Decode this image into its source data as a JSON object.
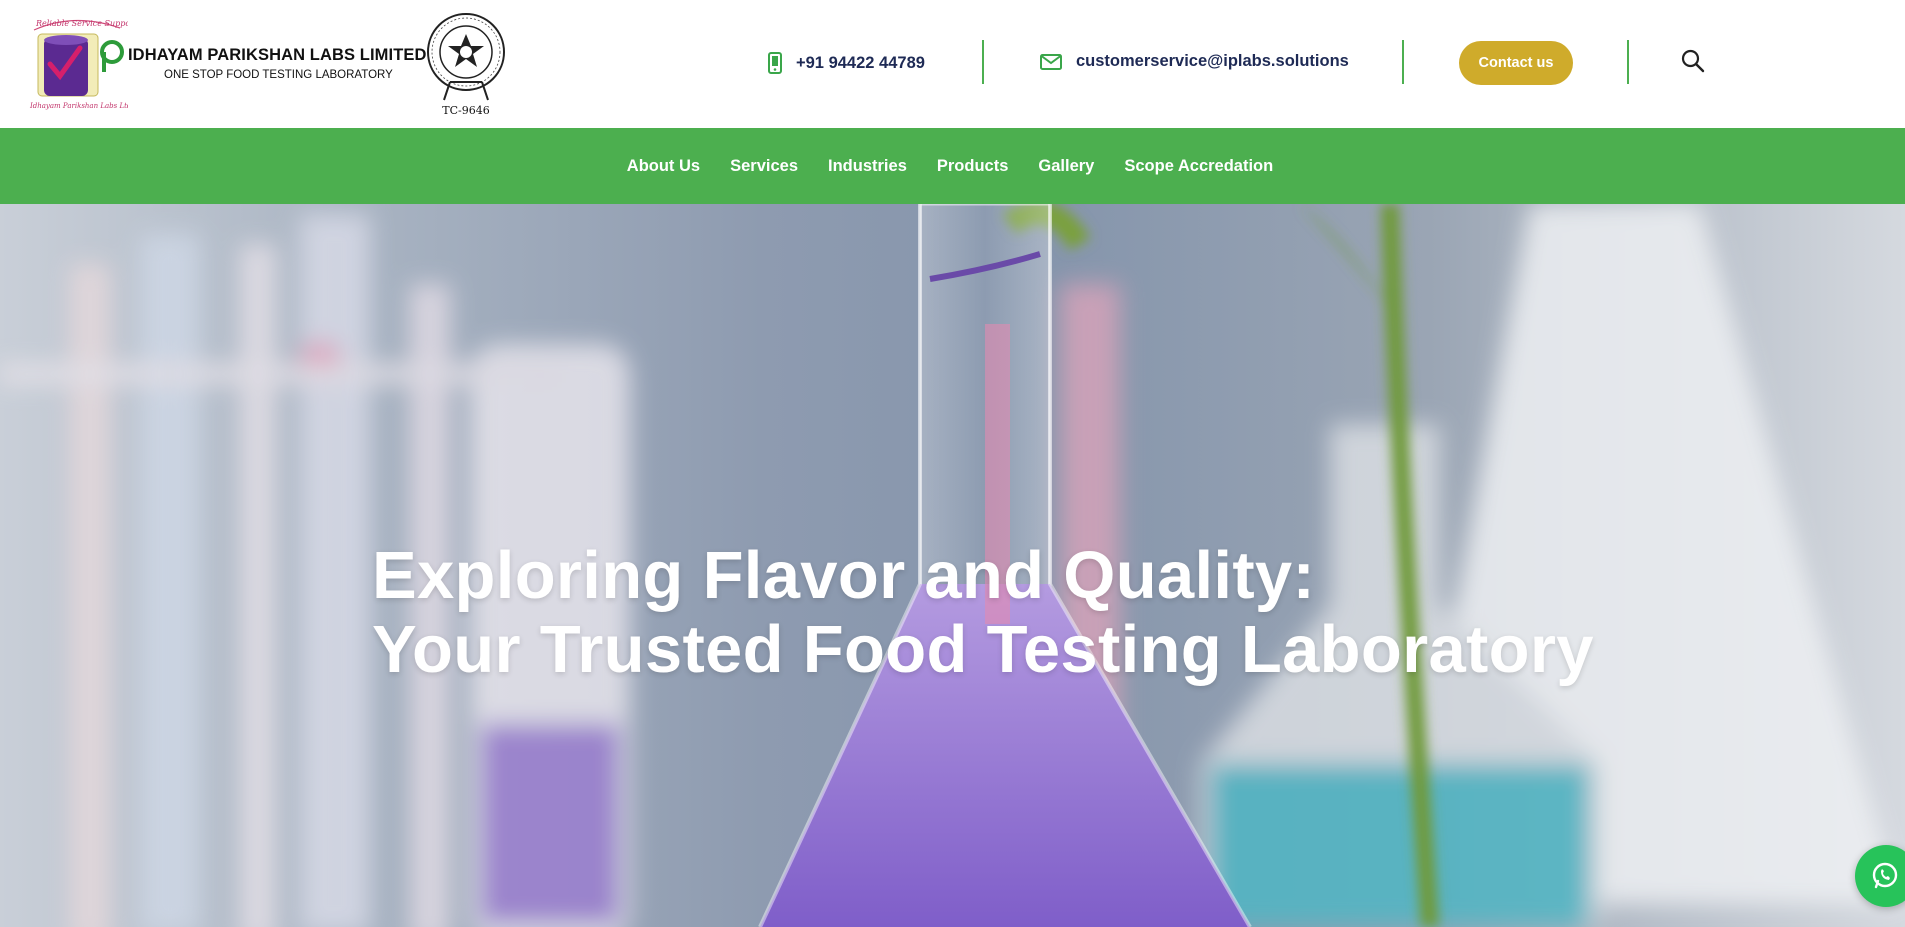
{
  "header": {
    "company_name": "IDHAYAM PARIKSHAN LABS LIMITED",
    "tagline": "ONE STOP FOOD TESTING LABORATORY",
    "logo_ring_text": "Reliable Service Support",
    "logo_bottom_text": "Idhayam Parikshan Labs Ltd",
    "seal_code": "TC-9646",
    "phone": "+91 94422 44789",
    "email": "customerservice@iplabs.solutions",
    "contact_button": "Contact us",
    "icons": {
      "phone": "mobile-phone-icon",
      "email": "envelope-icon",
      "search": "search-icon"
    }
  },
  "nav": {
    "items": [
      "About Us",
      "Services",
      "Industries",
      "Products",
      "Gallery",
      "Scope Accredation"
    ]
  },
  "hero": {
    "title_line1": "Exploring Flavor and Quality:",
    "title_line2": "Your Trusted Food Testing Laboratory"
  },
  "colors": {
    "nav_green": "#4caf4f",
    "accent_gold": "#cfab2b",
    "contact_text": "#1e2a55",
    "whatsapp_green": "#27c35a"
  },
  "floating": {
    "icon": "whatsapp-icon"
  }
}
